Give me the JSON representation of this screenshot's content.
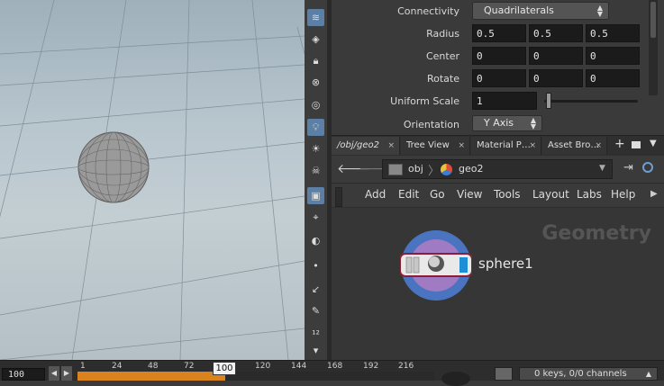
{
  "viewport": {
    "object": "sphere"
  },
  "params": {
    "connectivity": {
      "label": "Connectivity",
      "value": "Quadrilaterals"
    },
    "radius": {
      "label": "Radius",
      "values": [
        "0.5",
        "0.5",
        "0.5"
      ]
    },
    "center": {
      "label": "Center",
      "values": [
        "0",
        "0",
        "0"
      ]
    },
    "rotate": {
      "label": "Rotate",
      "values": [
        "0",
        "0",
        "0"
      ]
    },
    "uniform_scale": {
      "label": "Uniform Scale",
      "value": "1",
      "slider_fraction": 0.02
    },
    "orientation": {
      "label": "Orientation",
      "value": "Y Axis"
    }
  },
  "tabs": [
    {
      "label": "/obj/geo2",
      "close": "×"
    },
    {
      "label": "Tree View",
      "close": "×"
    },
    {
      "label": "Material P…",
      "close": "×"
    },
    {
      "label": "Asset Bro…",
      "close": "×"
    }
  ],
  "tab_add": "+",
  "path": {
    "root": "obj",
    "current": "geo2"
  },
  "menus": [
    "Add",
    "Edit",
    "Go",
    "View",
    "Tools",
    "Layout",
    "Labs",
    "Help"
  ],
  "network": {
    "context_label": "Geometry",
    "node_name": "sphere1"
  },
  "timeline": {
    "current_frame_field": "100",
    "ticks": [
      "1",
      "24",
      "48",
      "72",
      "120",
      "144",
      "168",
      "192",
      "216"
    ],
    "current_frame_marker": "100",
    "keys_channels": "0 keys, 0/0 channels"
  },
  "colors": {
    "accent": "#5c7fa5",
    "timeline_range": "#d9821e",
    "node_ring": "#4870b8"
  }
}
